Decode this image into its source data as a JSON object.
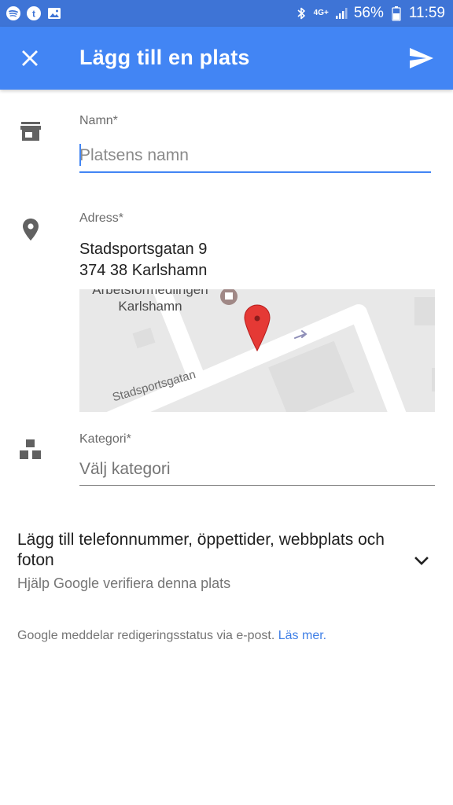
{
  "status_bar": {
    "network": "4G+",
    "battery": "56%",
    "time": "11:59"
  },
  "app_bar": {
    "title": "Lägg till en plats",
    "close_icon": "close-icon",
    "send_icon": "send-icon"
  },
  "name_field": {
    "label": "Namn*",
    "placeholder": "Platsens namn",
    "value": ""
  },
  "address_field": {
    "label": "Adress*",
    "line1": "Stadsportsgatan 9",
    "line2": "374 38 Karlshamn",
    "map": {
      "poi_label_line1": "Arbetsförmedlingen",
      "poi_label_line2": "Karlshamn",
      "street_label": "Stadsportsgatan"
    }
  },
  "category_field": {
    "label": "Kategori*",
    "value": "Välj kategori"
  },
  "more_details": {
    "title": "Lägg till telefonnummer, öppettider, webbplats och foton",
    "subtitle": "Hjälp Google verifiera denna plats"
  },
  "footer": {
    "note": "Google meddelar redigeringsstatus via e-post.",
    "link": "Läs mer."
  },
  "colors": {
    "app_bar": "#4285f4",
    "status_bar": "#3e74d6",
    "accent": "#4285f4",
    "marker": "#e53935"
  }
}
